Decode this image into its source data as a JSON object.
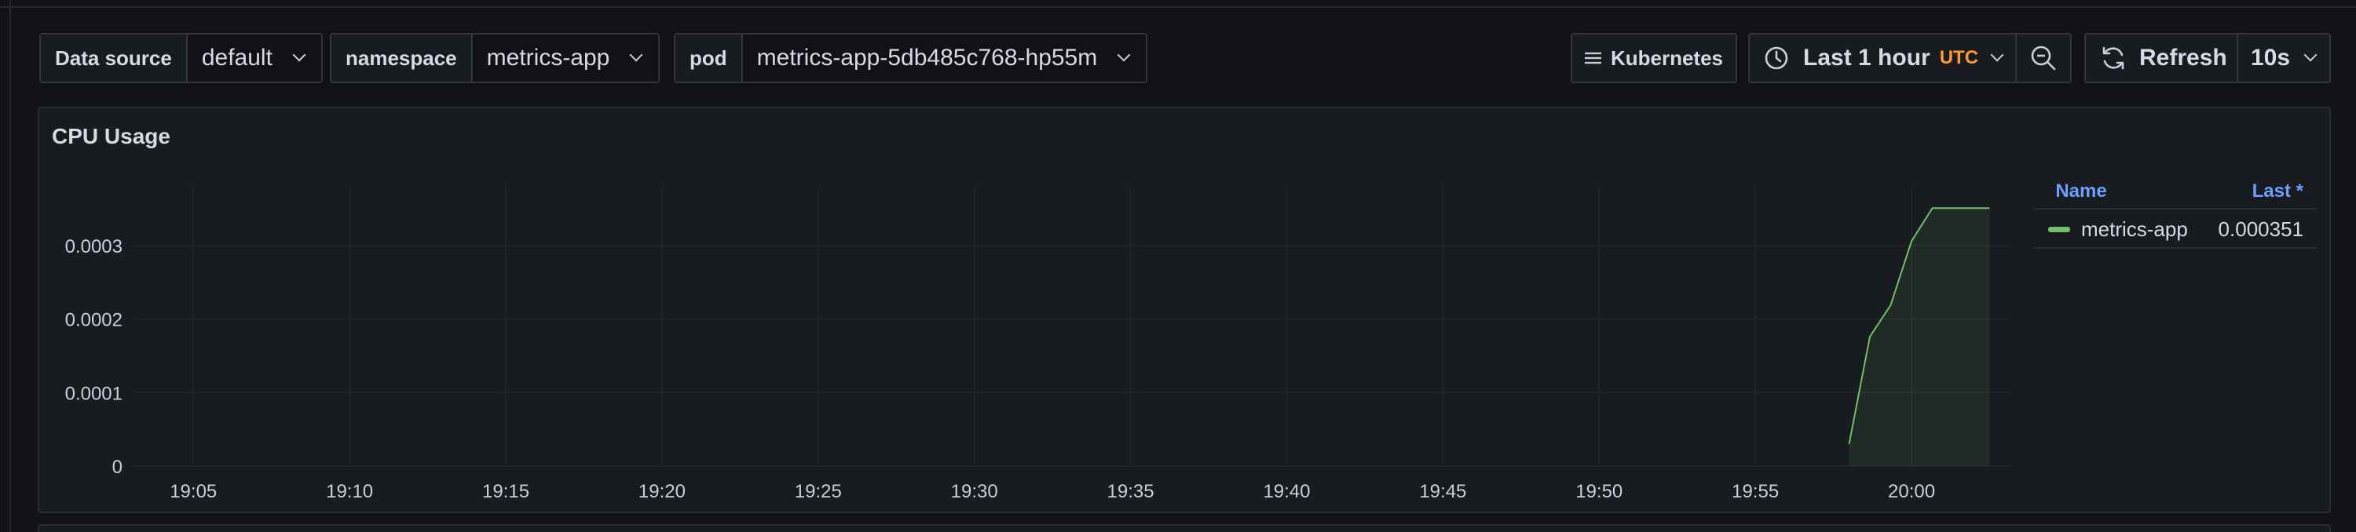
{
  "variables": [
    {
      "label": "Data source",
      "value": "default"
    },
    {
      "label": "namespace",
      "value": "metrics-app"
    },
    {
      "label": "pod",
      "value": "metrics-app-5db485c768-hp55m"
    }
  ],
  "toolbar": {
    "dashboard_link": "Kubernetes",
    "time_range": "Last 1 hour",
    "timezone": "UTC",
    "refresh_label": "Refresh",
    "refresh_interval": "10s"
  },
  "panel": {
    "title": "CPU Usage",
    "legend": {
      "name_header": "Name",
      "last_header": "Last *",
      "rows": [
        {
          "name": "metrics-app",
          "last": "0.000351",
          "color": "#73bf69"
        }
      ]
    }
  },
  "colors": {
    "accent_link": "#6e9fff",
    "timezone": "#ff9830",
    "series": "#73bf69"
  },
  "chart_data": {
    "type": "area",
    "title": "CPU Usage",
    "xlabel": "",
    "ylabel": "",
    "x_ticks": [
      "19:05",
      "19:10",
      "19:15",
      "19:20",
      "19:25",
      "19:30",
      "19:35",
      "19:40",
      "19:45",
      "19:50",
      "19:55",
      "20:00"
    ],
    "y_ticks": [
      "0",
      "0.0001",
      "0.0002",
      "0.0003"
    ],
    "ylim": [
      0,
      0.00038
    ],
    "xlim": [
      "19:03:05",
      "20:03:10"
    ],
    "grid": true,
    "legend_position": "right",
    "series": [
      {
        "name": "metrics-app",
        "x": [
          "19:58:00",
          "19:58:40",
          "19:59:20",
          "20:00:00",
          "20:00:40",
          "20:01:20",
          "20:02:00",
          "20:02:30"
        ],
        "values": [
          3e-05,
          0.000176,
          0.000219,
          0.000306,
          0.000351,
          0.000351,
          0.000351,
          0.000351
        ]
      }
    ]
  }
}
